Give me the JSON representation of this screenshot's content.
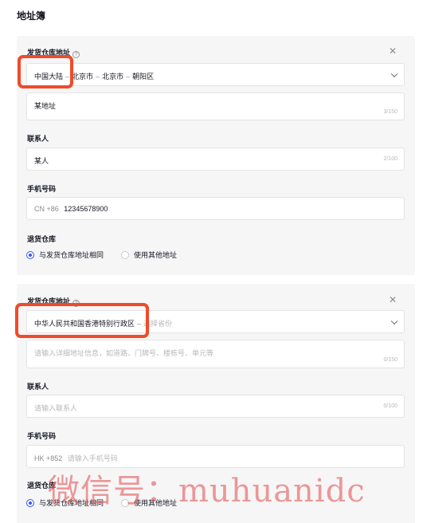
{
  "page": {
    "title": "地址簿"
  },
  "cards": [
    {
      "address_label": "发货仓库地址",
      "region": [
        "中国大陆",
        "北京市",
        "北京市",
        "朝阳区"
      ],
      "region_placeholder": "",
      "detail_value": "某地址",
      "detail_placeholder": "",
      "detail_count": "3/150",
      "contact_label": "联系人",
      "contact_value": "某人",
      "contact_placeholder": "",
      "contact_count": "2/100",
      "phone_label": "手机号码",
      "phone_prefix": "CN +86",
      "phone_value": "12345678900",
      "phone_placeholder": "",
      "return_label": "退货仓库",
      "return_options": [
        "与发货仓库地址相同",
        "使用其他地址"
      ],
      "return_selected": 0
    },
    {
      "address_label": "发货仓库地址",
      "region": [
        "中华人民共和国香港特别行政区"
      ],
      "region_placeholder": "选择省份",
      "detail_value": "",
      "detail_placeholder": "请输入详细地址信息，如道路、门牌号、楼栋号、单元等",
      "detail_count": "0/150",
      "contact_label": "联系人",
      "contact_value": "",
      "contact_placeholder": "请输入联系人",
      "contact_count": "0/100",
      "phone_label": "手机号码",
      "phone_prefix": "HK +852",
      "phone_value": "",
      "phone_placeholder": "请输入手机号码",
      "return_label": "退货仓库",
      "return_options": [
        "与发货仓库地址相同",
        "使用其他地址"
      ],
      "return_selected": 0
    }
  ],
  "watermark": "微信号：muhuanidc",
  "colors": {
    "accent": "#3955f6",
    "highlight": "#ef4b2a",
    "card_bg": "#f6f6f7"
  }
}
